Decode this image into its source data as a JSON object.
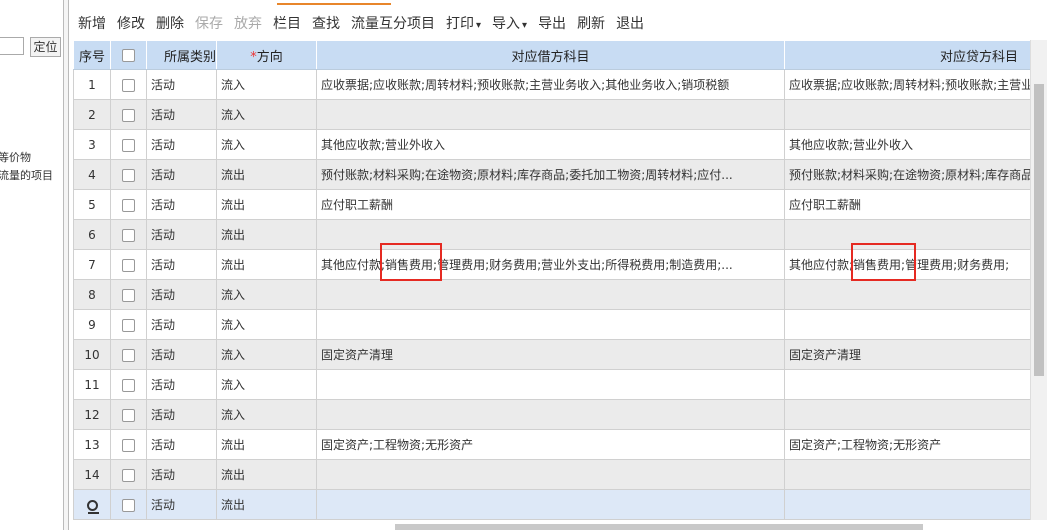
{
  "left": {
    "locate_button": "定位",
    "text1": "等价物",
    "text2": "流量的项目"
  },
  "toolbar": {
    "items": [
      "新增",
      "修改",
      "删除",
      "保存",
      "放弃",
      "栏目",
      "查找",
      "流量互分项目",
      "打印",
      "导入",
      "导出",
      "刷新",
      "退出"
    ],
    "disabled": [
      "保存",
      "放弃"
    ],
    "dropdown": [
      "打印",
      "导入"
    ]
  },
  "grid": {
    "headers": {
      "no": "序号",
      "category": "所属类别",
      "direction": "方向",
      "debit": "对应借方科目",
      "credit": "对应贷方科目"
    },
    "rows": [
      {
        "no": "1",
        "category": "活动",
        "direction": "流入",
        "debit": "应收票据;应收账款;周转材料;预收账款;主营业务收入;其他业务收入;销项税额",
        "credit": "应收票据;应收账款;周转材料;预收账款;主营业务收入"
      },
      {
        "no": "2",
        "category": "活动",
        "direction": "流入",
        "debit": "",
        "credit": ""
      },
      {
        "no": "3",
        "category": "活动",
        "direction": "流入",
        "debit": "其他应收款;营业外收入",
        "credit": "其他应收款;营业外收入"
      },
      {
        "no": "4",
        "category": "活动",
        "direction": "流出",
        "debit": "预付账款;材料采购;在途物资;原材料;库存商品;委托加工物资;周转材料;应付...",
        "credit": "预付账款;材料采购;在途物资;原材料;库存商品"
      },
      {
        "no": "5",
        "category": "活动",
        "direction": "流出",
        "debit": "应付职工薪酬",
        "credit": "应付职工薪酬"
      },
      {
        "no": "6",
        "category": "活动",
        "direction": "流出",
        "debit": "",
        "credit": ""
      },
      {
        "no": "7",
        "category": "活动",
        "direction": "流出",
        "debit": "其他应付款;销售费用;管理费用;财务费用;营业外支出;所得税费用;制造费用;...",
        "credit": "其他应付款;销售费用;管理费用;财务费用;"
      },
      {
        "no": "8",
        "category": "活动",
        "direction": "流入",
        "debit": "",
        "credit": ""
      },
      {
        "no": "9",
        "category": "活动",
        "direction": "流入",
        "debit": "",
        "credit": ""
      },
      {
        "no": "10",
        "category": "活动",
        "direction": "流入",
        "debit": "固定资产清理",
        "credit": "固定资产清理"
      },
      {
        "no": "11",
        "category": "活动",
        "direction": "流入",
        "debit": "",
        "credit": ""
      },
      {
        "no": "12",
        "category": "活动",
        "direction": "流入",
        "debit": "",
        "credit": ""
      },
      {
        "no": "13",
        "category": "活动",
        "direction": "流出",
        "debit": "固定资产;工程物资;无形资产",
        "credit": "固定资产;工程物资;无形资产"
      },
      {
        "no": "14",
        "category": "活动",
        "direction": "流出",
        "debit": "",
        "credit": ""
      },
      {
        "no": "",
        "category": "活动",
        "direction": "流出",
        "debit": "",
        "credit": ""
      }
    ]
  }
}
